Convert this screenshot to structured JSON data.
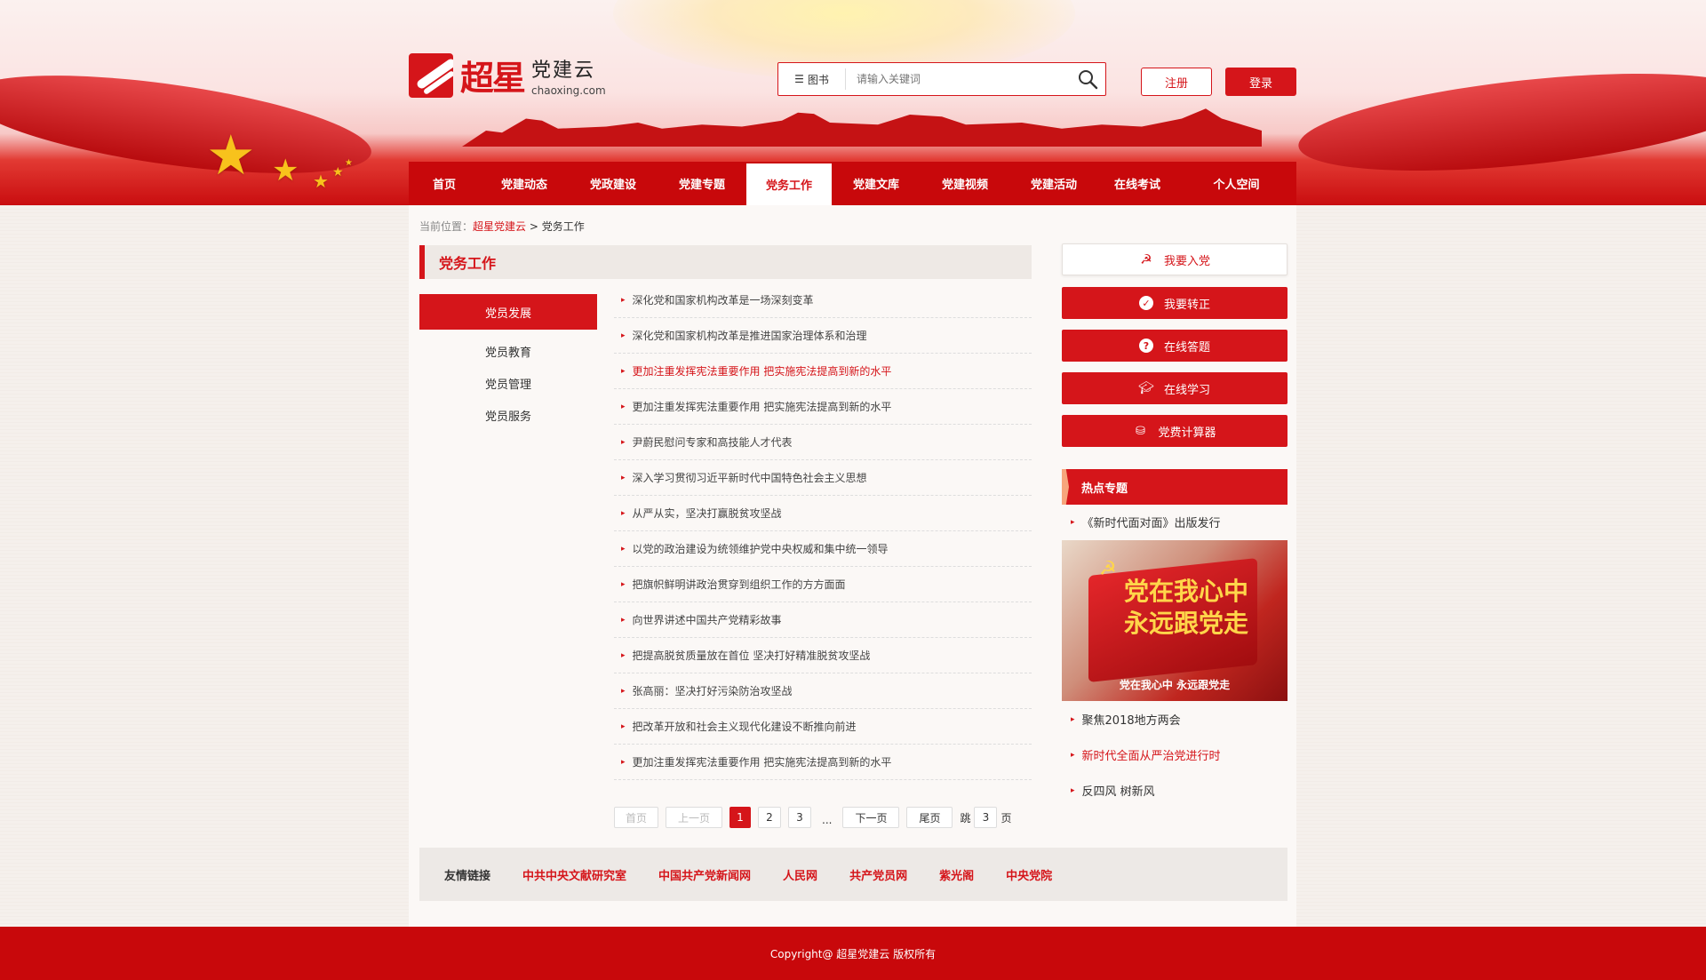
{
  "header": {
    "brand_cn": "超星",
    "site_name": "党建云",
    "site_domain": "chaoxing.com",
    "search": {
      "category": "图书",
      "placeholder": "请输入关键词"
    },
    "register_label": "注册",
    "login_label": "登录"
  },
  "nav": {
    "items": [
      {
        "label": "首页"
      },
      {
        "label": "党建动态"
      },
      {
        "label": "党政建设"
      },
      {
        "label": "党建专题"
      },
      {
        "label": "党务工作"
      },
      {
        "label": "党建文库"
      },
      {
        "label": "党建视频"
      },
      {
        "label": "党建活动"
      },
      {
        "label": "在线考试"
      },
      {
        "label": "个人空间"
      }
    ],
    "active_index": 4
  },
  "breadcrumb": {
    "prefix": "当前位置：",
    "home": "超星党建云",
    "sep": ">",
    "current": "党务工作"
  },
  "section": {
    "title": "党务工作"
  },
  "subnav": {
    "items": [
      {
        "label": "党员发展"
      },
      {
        "label": "党员教育"
      },
      {
        "label": "党员管理"
      },
      {
        "label": "党员服务"
      }
    ]
  },
  "articles": [
    {
      "title": "深化党和国家机构改革是一场深刻变革"
    },
    {
      "title": "深化党和国家机构改革是推进国家治理体系和治理"
    },
    {
      "title": "更加注重发挥宪法重要作用 把实施宪法提高到新的水平"
    },
    {
      "title": "更加注重发挥宪法重要作用 把实施宪法提高到新的水平"
    },
    {
      "title": "尹蔚民慰问专家和高技能人才代表"
    },
    {
      "title": "深入学习贯彻习近平新时代中国特色社会主义思想"
    },
    {
      "title": "从严从实，坚决打赢脱贫攻坚战"
    },
    {
      "title": "以党的政治建设为统领维护党中央权威和集中统一领导"
    },
    {
      "title": "把旗帜鲜明讲政治贯穿到组织工作的方方面面"
    },
    {
      "title": "向世界讲述中国共产党精彩故事"
    },
    {
      "title": "把提高脱贫质量放在首位 坚决打好精准脱贫攻坚战"
    },
    {
      "title": "张高丽：坚决打好污染防治攻坚战"
    },
    {
      "title": "把改革开放和社会主义现代化建设不断推向前进"
    },
    {
      "title": "更加注重发挥宪法重要作用 把实施宪法提高到新的水平"
    }
  ],
  "pager": {
    "first": "首页",
    "prev": "上一页",
    "pages": [
      "1",
      "2",
      "3"
    ],
    "ellipsis": "...",
    "next": "下一页",
    "last": "尾页",
    "jump_label": "跳",
    "jump_value": "3",
    "page_unit": "页",
    "current": 1
  },
  "sidebar": {
    "buttons": [
      {
        "label": "我要入党",
        "icon": "party-emblem-icon"
      },
      {
        "label": "我要转正",
        "icon": "check-circle-icon"
      },
      {
        "label": "在线答题",
        "icon": "question-circle-icon"
      },
      {
        "label": "在线学习",
        "icon": "graduation-cap-icon"
      },
      {
        "label": "党费计算器",
        "icon": "coins-icon"
      }
    ],
    "hot_title": "热点专题",
    "hot_items": [
      {
        "label": "《新时代面对面》出版发行"
      },
      {
        "label": "聚焦2018地方两会"
      },
      {
        "label": "新时代全面从严治党进行时"
      },
      {
        "label": "反四风 树新风"
      }
    ],
    "hot_image": {
      "line1": "党在我心中",
      "line2": "永远跟党走",
      "caption": "党在我心中 永远跟党走"
    }
  },
  "links": {
    "label": "友情链接",
    "items": [
      "中共中央文献研究室",
      "中国共产党新闻网",
      "人民网",
      "共产党员网",
      "紫光阁",
      "中央党院"
    ]
  },
  "footer": {
    "copyright": "Copyright@ 超星党建云  版权所有"
  },
  "colors": {
    "brand_red": "#d5151a",
    "nav_red": "#c8080b",
    "gold": "#f8c21c"
  }
}
